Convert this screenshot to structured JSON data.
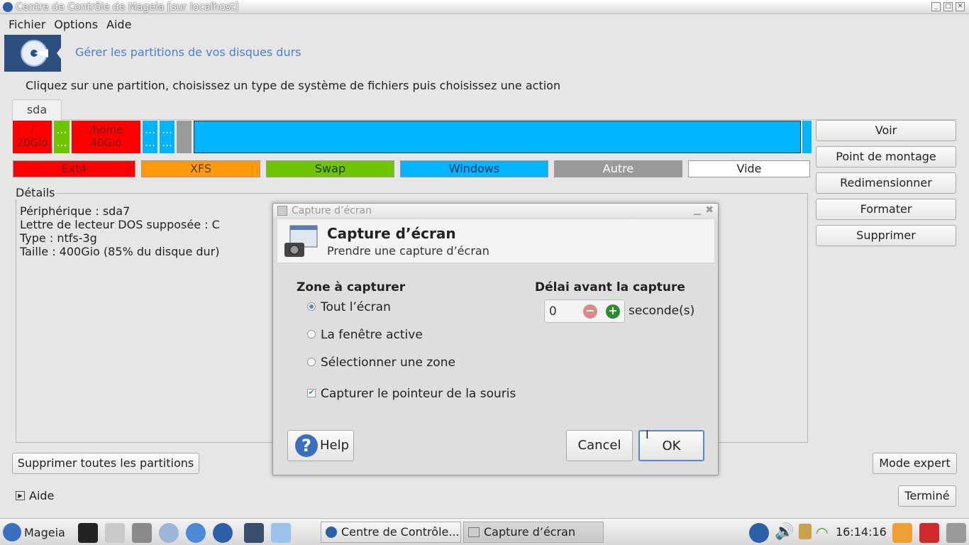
{
  "window": {
    "title": "Centre de Contrôle de Mageia  [sur localhost]"
  },
  "menu": [
    "Fichier",
    "Options",
    "Aide"
  ],
  "header": {
    "title": "Gérer les partitions de vos disques durs"
  },
  "instruction": "Cliquez sur une partition, choisissez un type de système de fichiers puis choisissez une action",
  "tabs": [
    "sda"
  ],
  "partitions": [
    {
      "line1": "/",
      "line2": "20Gio",
      "color": "#ff0000"
    },
    {
      "line1": "…",
      "line2": "…",
      "color": "#6ec400"
    },
    {
      "line1": "/home",
      "line2": "40Gio",
      "color": "#ff0000"
    },
    {
      "line1": "…",
      "line2": "…",
      "color": "#00b4ff"
    },
    {
      "line1": "…",
      "line2": "…",
      "color": "#00b4ff"
    },
    {
      "line1": "",
      "line2": "",
      "color": "#9a9a9a"
    },
    {
      "line1": "",
      "line2": "",
      "color": "#00b4ff"
    },
    {
      "line1": "",
      "line2": "",
      "color": "#00b4ff"
    }
  ],
  "legend": [
    {
      "label": "Ext4",
      "color": "#ff0000"
    },
    {
      "label": "XFS",
      "color": "#ff9a0a"
    },
    {
      "label": "Swap",
      "color": "#6ec400"
    },
    {
      "label": "Windows",
      "color": "#00b4ff"
    },
    {
      "label": "Autre",
      "color": "#9a9a9a"
    },
    {
      "label": "Vide",
      "color": "#ffffff"
    }
  ],
  "details": {
    "label": "Détails",
    "lines": [
      "Périphérique : sda7",
      "Lettre de lecteur DOS supposée : C",
      "Type : ntfs-3g",
      "Taille : 400Gio (85% du disque dur)"
    ]
  },
  "actions": [
    "Voir",
    "Point de montage",
    "Redimensionner",
    "Formater",
    "Supprimer"
  ],
  "bottom": {
    "delete_all": "Supprimer toutes les partitions",
    "expert": "Mode expert",
    "aide": "Aide",
    "done": "Terminé"
  },
  "dialog": {
    "window_title": "Capture d’écran",
    "title": "Capture d’écran",
    "subtitle": "Prendre une capture d’écran",
    "zone_label": "Zone à capturer",
    "options": [
      "Tout l’écran",
      "La fenêtre active",
      "Sélectionner une zone"
    ],
    "selected_option": 0,
    "pointer_label": "Capturer le pointeur de la souris",
    "pointer_checked": true,
    "delay_label": "Délai avant la capture",
    "delay_value": "0",
    "delay_unit": "seconde(s)",
    "help": "Help",
    "cancel": "Cancel",
    "ok": "OK"
  },
  "taskbar": {
    "start": "Mageia",
    "tasks": [
      "Centre de Contrôle...",
      "Capture d’écran"
    ],
    "clock": "16:14:16"
  }
}
